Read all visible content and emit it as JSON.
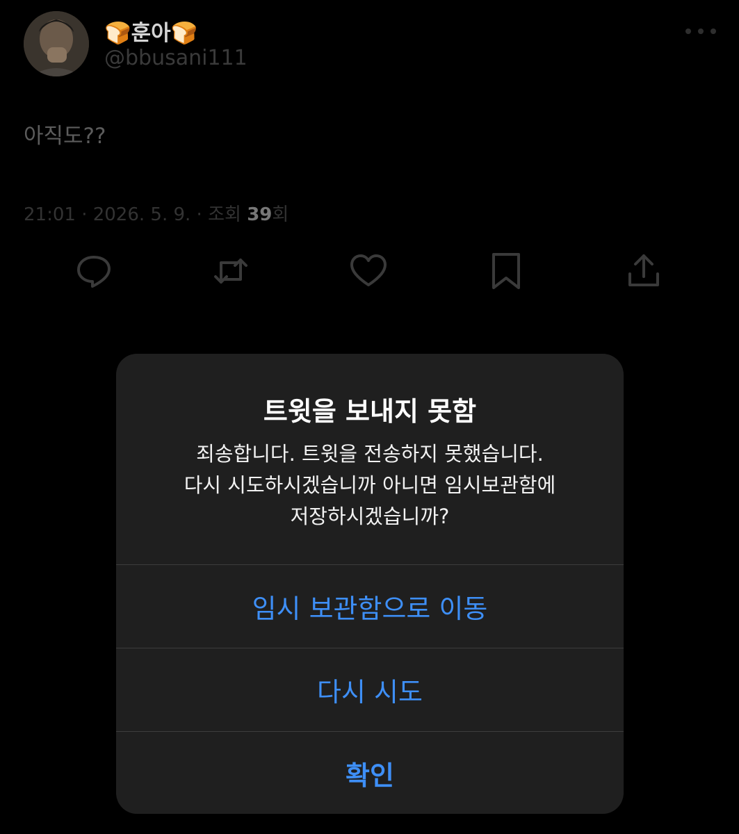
{
  "tweet": {
    "author": {
      "display_name": "🍞훈아🍞",
      "handle": "@bbusani111"
    },
    "text": "아직도??",
    "meta": {
      "time_date": "21:01 · 2026. 5. 9. · 조회 ",
      "view_count": "39",
      "view_suffix": "회"
    },
    "actions": [
      "reply-icon",
      "retweet-icon",
      "like-icon",
      "bookmark-icon",
      "share-icon"
    ]
  },
  "dialog": {
    "title": "트윗을 보내지 못함",
    "message_lines": [
      "죄송합니다. 트윗을 전송하지 못했습니다.",
      "다시 시도하시겠습니까 아니면 임시보관함에",
      "저장하시겠습니까?"
    ],
    "buttons": {
      "drafts": "임시 보관함으로 이동",
      "retry": "다시 시도",
      "ok": "확인"
    }
  },
  "colors": {
    "background": "#000000",
    "dialog_bg": "#1f1f1f",
    "accent": "#3e8ff7",
    "icon_dim": "#3a3a3a"
  }
}
